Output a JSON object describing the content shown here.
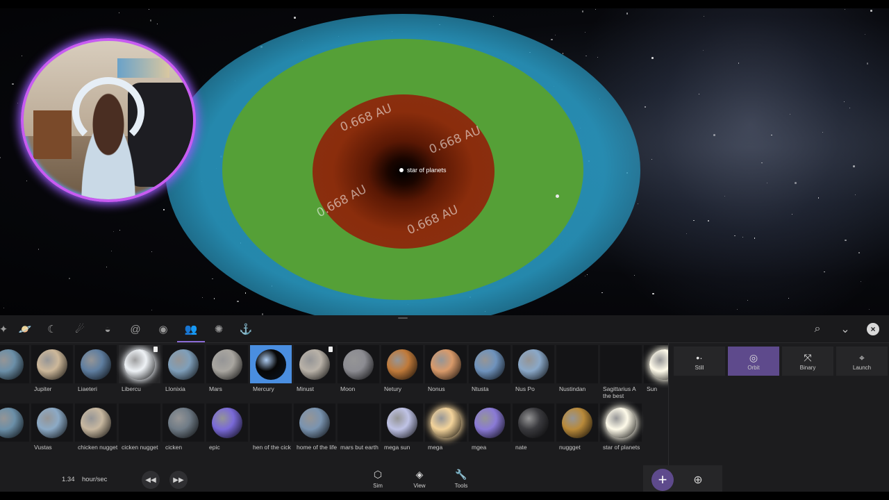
{
  "viewport": {
    "au_labels": [
      "0.668 AU",
      "0.668 AU",
      "0.668 AU",
      "0.668 AU"
    ],
    "selected_object_name": "star of planets",
    "zone_colors": {
      "outer": "#2896be",
      "middle": "#55a037",
      "inner": "#8b2e10"
    }
  },
  "category_bar": {
    "icons": [
      "asteroid-icon",
      "planet-icon",
      "moon-icon",
      "comet-icon",
      "ufo-icon",
      "galaxy-icon",
      "eye-icon",
      "people-icon",
      "sun-icon",
      "anchor-icon"
    ],
    "active_index": 7,
    "right_tools": [
      "search-icon",
      "chevron-down-icon",
      "close-icon"
    ]
  },
  "object_grid": {
    "row1": [
      {
        "label": "ar",
        "color": "#6b8fa8"
      },
      {
        "label": "Jupiter",
        "color": "#cdb89a"
      },
      {
        "label": "Liaeteri",
        "color": "#5f7ea0"
      },
      {
        "label": "Libercu",
        "color": "#eef2f6"
      },
      {
        "label": "Llonixia",
        "color": "#7f9fba"
      },
      {
        "label": "Mars",
        "color": "#a9a6a0"
      },
      {
        "label": "Mercury",
        "color": "#070707"
      },
      {
        "label": "Minust",
        "color": "#b9b2a8"
      },
      {
        "label": "Moon",
        "color": "#8c8c92"
      },
      {
        "label": "Netury",
        "color": "#c07a3a"
      },
      {
        "label": "Nonus",
        "color": "#d99a6a"
      },
      {
        "label": "Ntusta",
        "color": "#6f93bd"
      },
      {
        "label": "Nus Po",
        "color": "#8aa8c8"
      },
      {
        "label": "Nustindan",
        "color": "#141416"
      },
      {
        "label": "Sagittarius A the best",
        "color": "#141416"
      },
      {
        "label": "Sun",
        "color": "#fffbea"
      }
    ],
    "row2": [
      {
        "label": "",
        "color": "#6b8fa8"
      },
      {
        "label": "Vustas",
        "color": "#8caac6"
      },
      {
        "label": "chicken nugget",
        "color": "#c8b8a0"
      },
      {
        "label": "cicken nugget",
        "color": "#141416"
      },
      {
        "label": "cicken",
        "color": "#6f7b86"
      },
      {
        "label": "epic",
        "color": "#7a6ad8"
      },
      {
        "label": "hen of the cick",
        "color": "#141416"
      },
      {
        "label": "home of the life",
        "color": "#7a94b0"
      },
      {
        "label": "mars but earth",
        "color": "#141416"
      },
      {
        "label": "mega sun",
        "color": "#bfc3e6"
      },
      {
        "label": "mega",
        "color": "#f3d39a"
      },
      {
        "label": "mgea",
        "color": "#8a7ad6"
      },
      {
        "label": "nate",
        "color": "#3a3a3e"
      },
      {
        "label": "nuggget",
        "color": "#b98a3a"
      },
      {
        "label": "star of planets",
        "color": "#fffbea"
      }
    ]
  },
  "motion_modes": [
    {
      "label": "Still",
      "icon": "still-icon"
    },
    {
      "label": "Orbit",
      "icon": "orbit-icon"
    },
    {
      "label": "Binary",
      "icon": "binary-icon"
    },
    {
      "label": "Launch",
      "icon": "launch-icon"
    }
  ],
  "active_mode": "Orbit",
  "footer": {
    "speed_value": "1.34",
    "speed_unit": "hour/sec",
    "tabs": [
      {
        "label": "Sim",
        "icon": "cube-icon"
      },
      {
        "label": "View",
        "icon": "layers-icon"
      },
      {
        "label": "Tools",
        "icon": "wrench-icon"
      }
    ],
    "add_symbol": "+"
  },
  "accent_color": "#5e4a8c"
}
